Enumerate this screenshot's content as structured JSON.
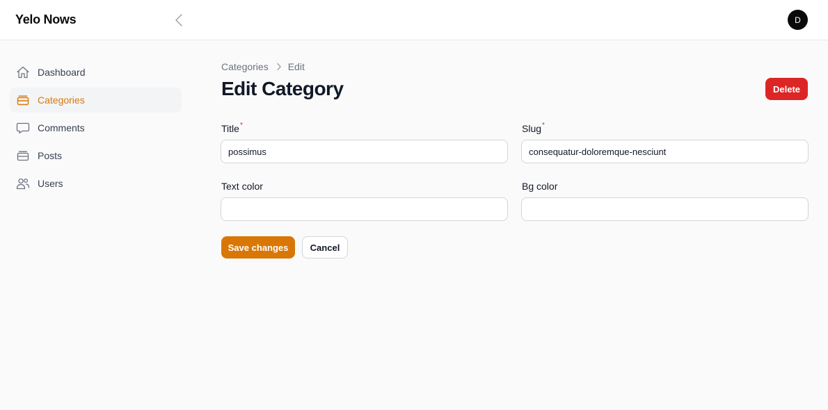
{
  "app": {
    "title": "Yelo Nows",
    "user_initial": "D"
  },
  "icons": {
    "collapse": "chevron-left-icon",
    "accent": "#d97706"
  },
  "sidebar": {
    "items": [
      {
        "label": "Dashboard",
        "icon": "home-icon",
        "active": false
      },
      {
        "label": "Categories",
        "icon": "inbox-stack-icon",
        "active": true
      },
      {
        "label": "Comments",
        "icon": "chat-bubble-icon",
        "active": false
      },
      {
        "label": "Posts",
        "icon": "inbox-stack-icon",
        "active": false
      },
      {
        "label": "Users",
        "icon": "users-icon",
        "active": false
      }
    ]
  },
  "breadcrumb": {
    "parent": "Categories",
    "current": "Edit"
  },
  "page": {
    "title": "Edit Category",
    "delete_label": "Delete"
  },
  "form": {
    "title": {
      "label": "Title",
      "value": "possimus",
      "required": true
    },
    "slug": {
      "label": "Slug",
      "value": "consequatur-doloremque-nesciunt",
      "required": true
    },
    "text_color": {
      "label": "Text color",
      "value": ""
    },
    "bg_color": {
      "label": "Bg color",
      "value": ""
    }
  },
  "actions": {
    "save_label": "Save changes",
    "cancel_label": "Cancel"
  },
  "colors": {
    "primary": "#d97706",
    "danger": "#dc2626"
  }
}
